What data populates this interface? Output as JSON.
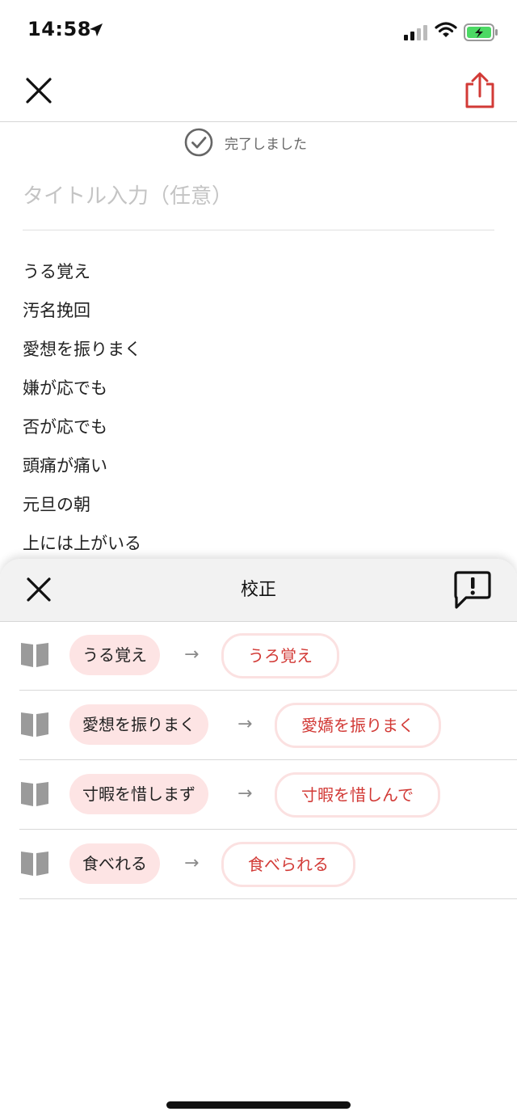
{
  "status_bar": {
    "time": "14:58"
  },
  "header": {
    "save_status": "完了しました"
  },
  "editor": {
    "title_placeholder": "タイトル入力（任意）",
    "lines": [
      "うる覚え",
      "汚名挽回",
      "愛想を振りまく",
      "嫌が応でも",
      "否が応でも",
      "頭痛が痛い",
      "元旦の朝",
      "上には上がいる"
    ]
  },
  "proofread_sheet": {
    "title": "校正",
    "arrow": "→",
    "corrections": [
      {
        "original": "うる覚え",
        "suggestion": "うろ覚え"
      },
      {
        "original": "愛想を振りまく",
        "suggestion": "愛嬌を振りまく"
      },
      {
        "original": "寸暇を惜しまず",
        "suggestion": "寸暇を惜しんで"
      },
      {
        "original": "食べれる",
        "suggestion": "食べられる"
      }
    ]
  },
  "colors": {
    "accent": "#d23a36",
    "chip_bg": "#fde4e4",
    "icon_gray": "#9a9a9a"
  }
}
